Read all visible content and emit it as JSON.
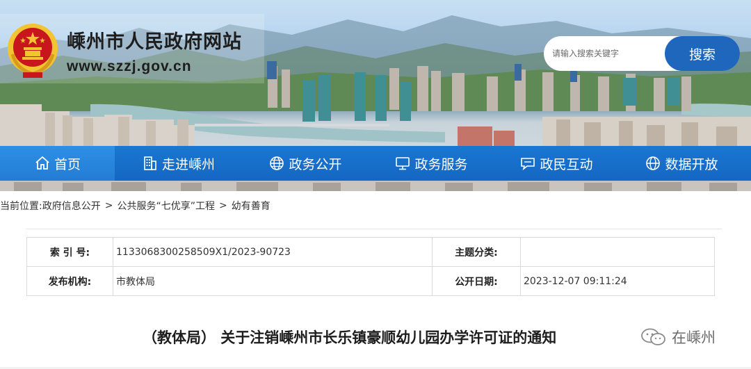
{
  "header": {
    "site_title": "嵊州市人民政府网站",
    "site_url": "www.szzj.gov.cn"
  },
  "search": {
    "placeholder": "请输入搜索关键字",
    "button_label": "搜索"
  },
  "nav": {
    "items": [
      {
        "label": "首页",
        "icon": "home-icon"
      },
      {
        "label": "走进嵊州",
        "icon": "building-icon"
      },
      {
        "label": "政务公开",
        "icon": "globe-icon"
      },
      {
        "label": "政务服务",
        "icon": "monitor-icon"
      },
      {
        "label": "政民互动",
        "icon": "chat-icon"
      },
      {
        "label": "数据开放",
        "icon": "database-icon"
      }
    ]
  },
  "breadcrumb": {
    "prefix": "当前位置:",
    "items": [
      "政府信息公开",
      "公共服务“七优享”工程",
      "幼有善育"
    ],
    "separator": ">"
  },
  "info": {
    "index_label": "索 引 号:",
    "index_value": "1133068300258509X1/2023-90723",
    "topic_label": "主题分类:",
    "topic_value": "",
    "publisher_label": "发布机构:",
    "publisher_value": "市教体局",
    "date_label": "公开日期:",
    "date_value": "2023-12-07 09:11:24"
  },
  "document": {
    "title": "（教体局） 关于注销嵊州市长乐镇豪顺幼儿园办学许可证的通知"
  },
  "watermark": {
    "text": "在嵊州"
  },
  "colors": {
    "nav_bg": "#1467c2",
    "nav_active": "#2a86de",
    "search_button": "#1f67bd",
    "emblem_red": "#c8161d",
    "emblem_gold": "#f3c431"
  }
}
